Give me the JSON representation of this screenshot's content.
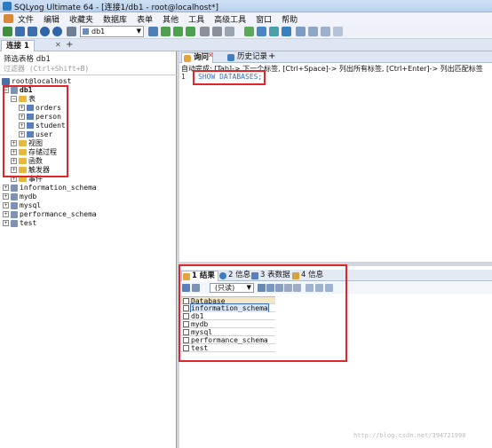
{
  "window": {
    "title": "SQLyog Ultimate 64 - [连接1/db1 - root@localhost*]"
  },
  "menu": [
    "文件",
    "编辑",
    "收藏夹",
    "数据库",
    "表单",
    "其他",
    "工具",
    "高级工具",
    "窗口",
    "帮助"
  ],
  "toolbar": {
    "db_selector": "db1"
  },
  "connection_tab": {
    "label": "连接 1"
  },
  "left_panel": {
    "filter_label": "筛选表格 db1",
    "filter_placeholder": "过滤器 (Ctrl+Shift+B)",
    "tree": {
      "root": "root@localhost",
      "db": "db1",
      "tables_label": "表",
      "tables": [
        "orders",
        "person",
        "student",
        "user"
      ],
      "folders": [
        "视图",
        "存储过程",
        "函数",
        "触发器",
        "事件"
      ],
      "other_dbs": [
        "information_schema",
        "mydb",
        "mysql",
        "performance_schema",
        "test"
      ]
    }
  },
  "editor": {
    "tabs": {
      "query": "询问",
      "history": "历史记录"
    },
    "hint": "自动完成: [Tab]-> 下一个标签, [Ctrl+Space]-> 列出所有标签, [Ctrl+Enter]-> 列出匹配标签",
    "line_number": "1",
    "sql": "SHOW DATABASES;"
  },
  "results": {
    "tabs": [
      "1 结果",
      "2 信息",
      "3 表数据",
      "4 信息"
    ],
    "readonly": "(只读)",
    "header": "Database",
    "rows": [
      "information_schema",
      "db1",
      "mydb",
      "mysql",
      "performance_schema",
      "test"
    ]
  },
  "watermark": "http://blog.csdn.net/394721990"
}
